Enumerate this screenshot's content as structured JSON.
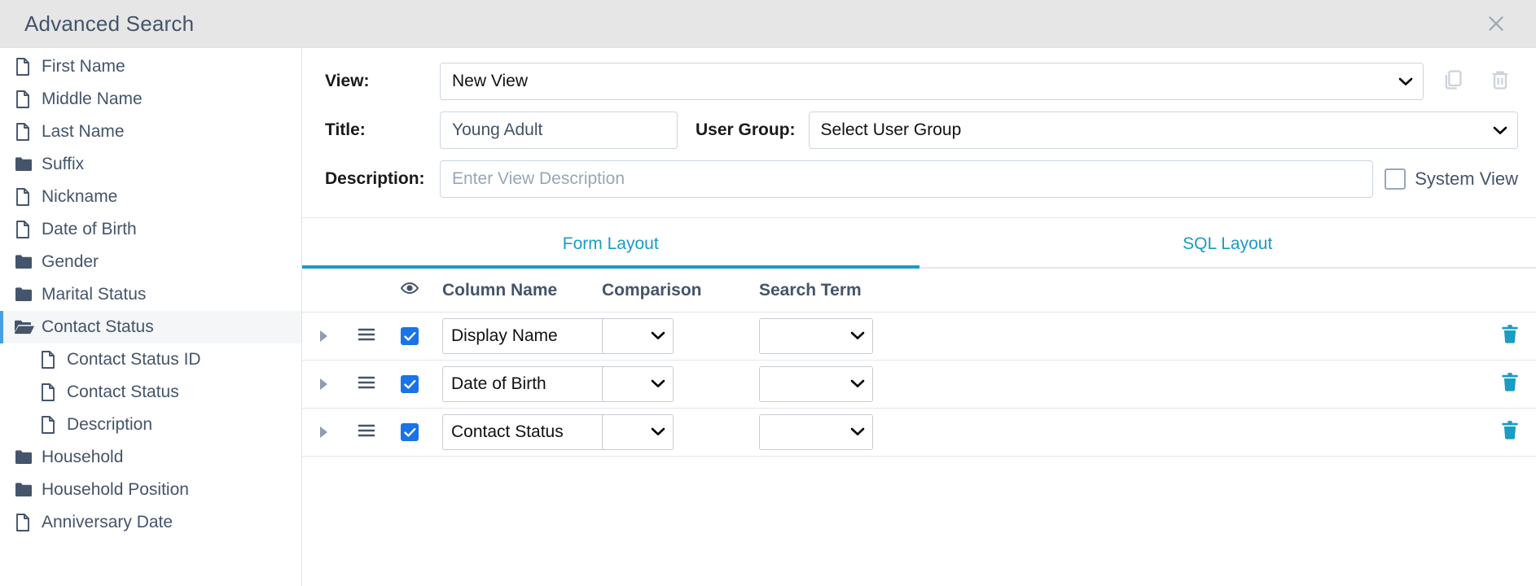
{
  "window": {
    "title": "Advanced Search",
    "close_icon": "close-icon"
  },
  "sidebar": {
    "items": [
      {
        "label": "First Name",
        "icon": "file-icon",
        "level": 0,
        "selected": false
      },
      {
        "label": "Middle Name",
        "icon": "file-icon",
        "level": 0,
        "selected": false
      },
      {
        "label": "Last Name",
        "icon": "file-icon",
        "level": 0,
        "selected": false
      },
      {
        "label": "Suffix",
        "icon": "folder-icon",
        "level": 0,
        "selected": false
      },
      {
        "label": "Nickname",
        "icon": "file-icon",
        "level": 0,
        "selected": false
      },
      {
        "label": "Date of Birth",
        "icon": "file-icon",
        "level": 0,
        "selected": false
      },
      {
        "label": "Gender",
        "icon": "folder-icon",
        "level": 0,
        "selected": false
      },
      {
        "label": "Marital Status",
        "icon": "folder-icon",
        "level": 0,
        "selected": false
      },
      {
        "label": "Contact Status",
        "icon": "folder-open-icon",
        "level": 0,
        "selected": true
      },
      {
        "label": "Contact Status ID",
        "icon": "file-icon",
        "level": 1,
        "selected": false
      },
      {
        "label": "Contact Status",
        "icon": "file-icon",
        "level": 1,
        "selected": false
      },
      {
        "label": "Description",
        "icon": "file-icon",
        "level": 1,
        "selected": false
      },
      {
        "label": "Household",
        "icon": "folder-icon",
        "level": 0,
        "selected": false
      },
      {
        "label": "Household Position",
        "icon": "folder-icon",
        "level": 0,
        "selected": false
      },
      {
        "label": "Anniversary Date",
        "icon": "file-icon",
        "level": 0,
        "selected": false
      }
    ]
  },
  "form": {
    "view_label": "View:",
    "view_value": "New View",
    "copy_icon": "copy-icon",
    "delete_icon": "trash-icon",
    "title_label": "Title:",
    "title_value": "Young Adult",
    "user_group_label": "User Group:",
    "user_group_value": "Select User Group",
    "description_label": "Description:",
    "description_placeholder": "Enter View Description",
    "description_value": "",
    "system_view_label": "System View",
    "system_view_checked": false
  },
  "tabs": [
    {
      "label": "Form Layout",
      "active": true
    },
    {
      "label": "SQL Layout",
      "active": false
    }
  ],
  "table": {
    "headers": {
      "visibility_icon": "eye-icon",
      "column_name": "Column Name",
      "comparison": "Comparison",
      "search_term": "Search Term"
    },
    "rows": [
      {
        "column_name": "Display Name",
        "comparison": "",
        "search_term": "",
        "visible": true,
        "expanded": false
      },
      {
        "column_name": "Date of Birth",
        "comparison": "",
        "search_term": "",
        "visible": true,
        "expanded": false
      },
      {
        "column_name": "Contact Status",
        "comparison": "",
        "search_term": "",
        "visible": true,
        "expanded": false
      }
    ]
  },
  "colors": {
    "accent_teal": "#1a9cc4",
    "checkbox_blue": "#1a73e8",
    "selection_blue": "#4a9fe0",
    "text_slate": "#44546a",
    "titlebar_bg": "#e6e6e6"
  }
}
